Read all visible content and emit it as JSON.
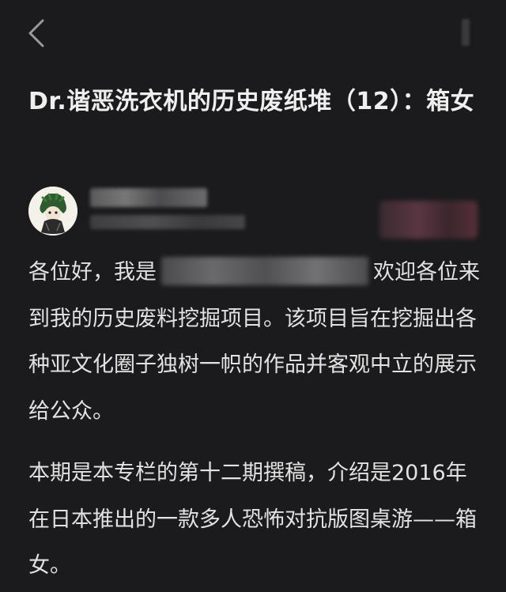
{
  "header": {
    "back_icon": "chevron-left-icon",
    "more_icon": "more-vertical-icon"
  },
  "article": {
    "title": "Dr.谐恶洗衣机的历史废纸堆（12）：箱女",
    "author": {
      "avatar_icon": "avatar"
    },
    "paragraph1": {
      "before_redaction": "各位好，我是",
      "after_redaction": "欢迎各位来到我的历史废料挖掘项目。该项目旨在挖掘出各种亚文化圈子独树一帜的作品并客观中立的展示给公众。"
    },
    "paragraph2": "本期是本专栏的第十二期撰稿，介绍是2016年在日本推出的一款多人恐怖对抗版图桌游——箱女。"
  },
  "colors": {
    "background": "#1b1b1d",
    "text": "#e2e2e2",
    "title": "#efefef"
  }
}
